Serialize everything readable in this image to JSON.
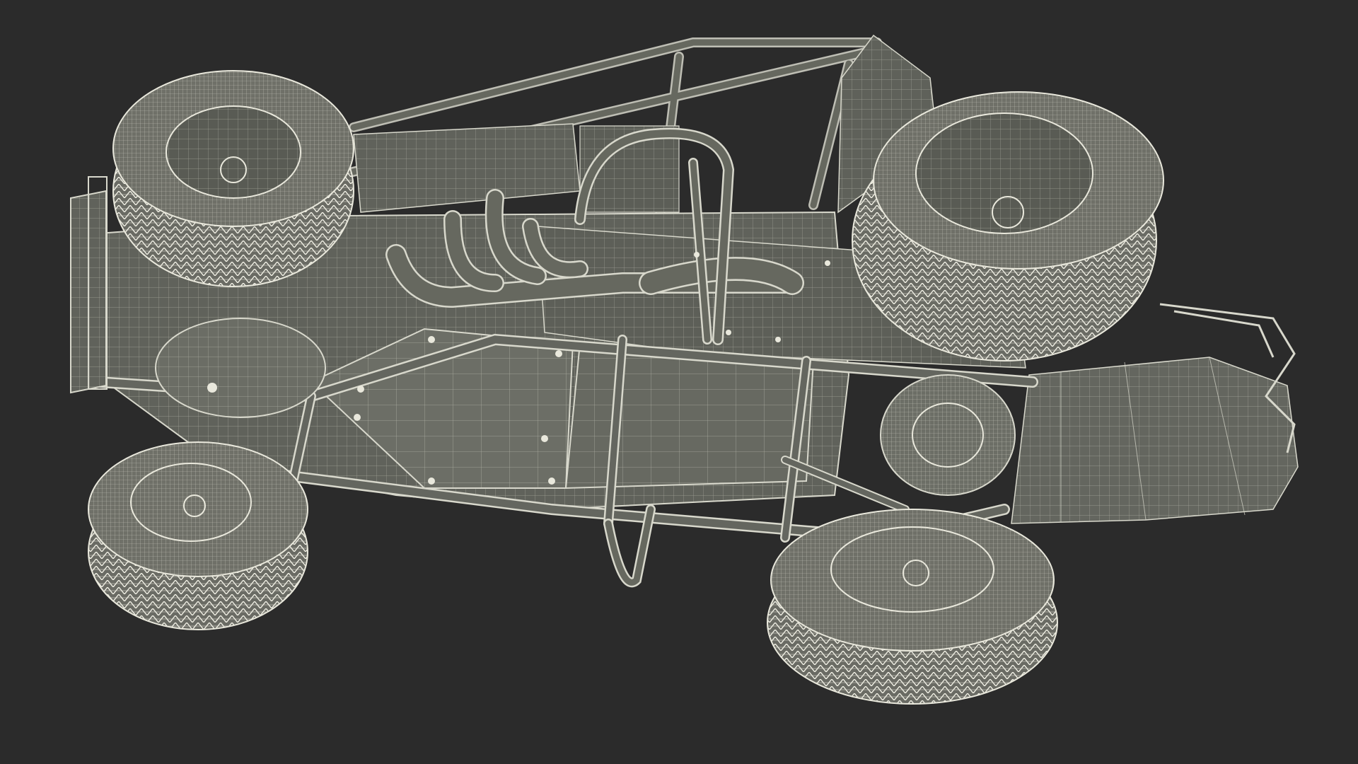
{
  "scene": {
    "background_color": "#2b2b2b",
    "model_fill_color": "#62645e",
    "model_dark_color": "#4a4c47",
    "wire_color": "#d8d8cc",
    "tire_wire_color": "#e9e8dc",
    "subject": "wireframe-sprint-car-underside"
  }
}
